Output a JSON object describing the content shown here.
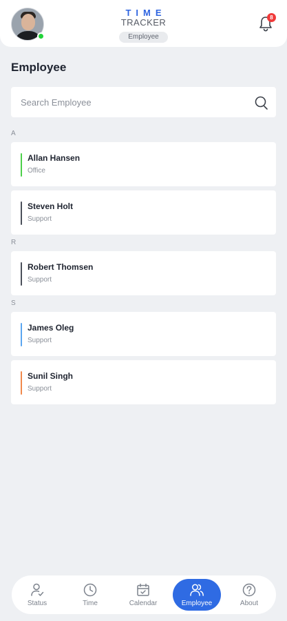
{
  "header": {
    "logo_line1": "TIME",
    "logo_line2": "TRACKER",
    "role": "Employee",
    "notification_count": "8",
    "user_status": "online"
  },
  "page": {
    "title": "Employee"
  },
  "search": {
    "placeholder": "Search Employee",
    "value": ""
  },
  "groups": [
    {
      "letter": "A",
      "employees": [
        {
          "name": "Allan Hansen",
          "dept": "Office",
          "color": "#4cd04a"
        },
        {
          "name": "Steven Holt",
          "dept": "Support",
          "color": "#4a4f5a"
        }
      ]
    },
    {
      "letter": "R",
      "employees": [
        {
          "name": "Robert Thomsen",
          "dept": "Support",
          "color": "#4a4f5a"
        }
      ]
    },
    {
      "letter": "S",
      "employees": [
        {
          "name": "James Oleg",
          "dept": "Support",
          "color": "#5aa6f0"
        },
        {
          "name": "Sunil Singh",
          "dept": "Support",
          "color": "#f0884a"
        }
      ]
    }
  ],
  "nav": {
    "active": "Employee",
    "items": [
      {
        "label": "Status",
        "icon": "person-check-icon"
      },
      {
        "label": "Time",
        "icon": "clock-icon"
      },
      {
        "label": "Calendar",
        "icon": "calendar-icon"
      },
      {
        "label": "Employee",
        "icon": "people-icon"
      },
      {
        "label": "About",
        "icon": "question-icon"
      }
    ]
  },
  "colors": {
    "accent": "#2f6be3",
    "online": "#22d33a",
    "badge": "#f03a3a"
  }
}
